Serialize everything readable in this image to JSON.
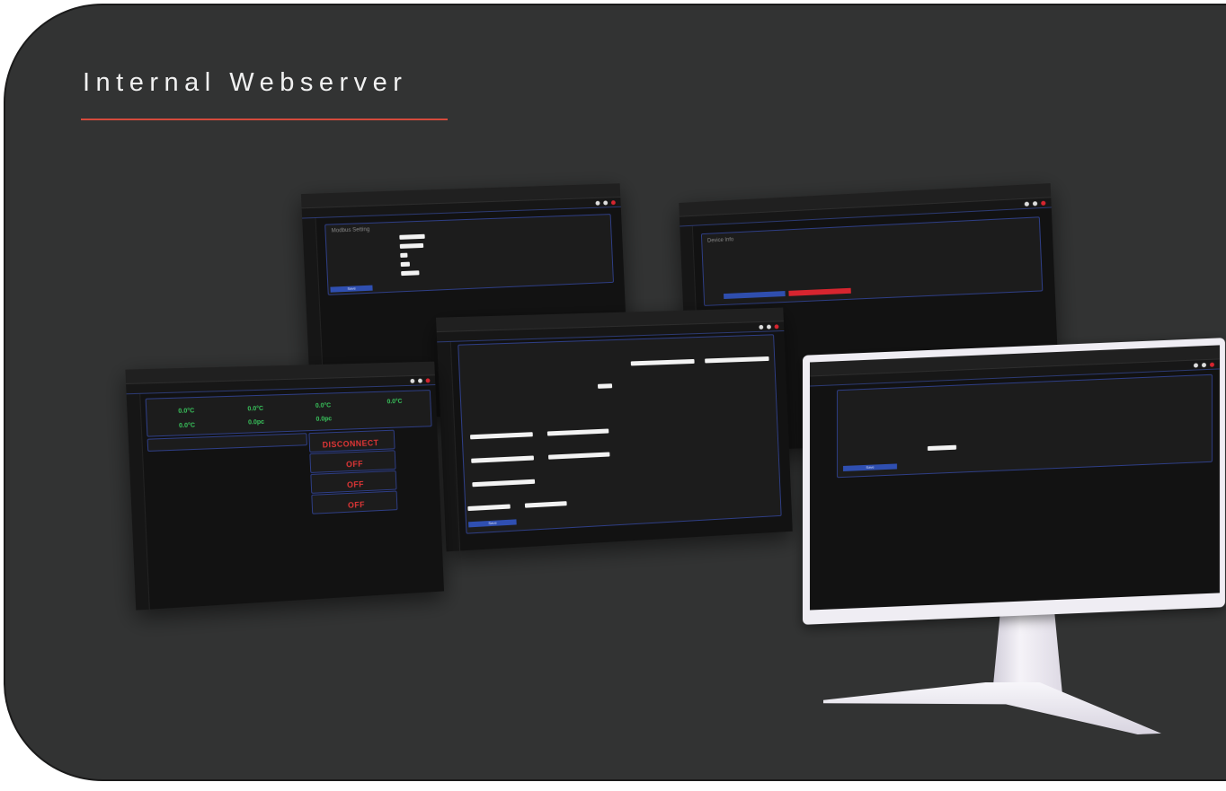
{
  "heading": {
    "title": "Internal Webserver"
  },
  "colors": {
    "background": "#323333",
    "accent_line": "#d54a3c",
    "screen_bg": "#121212",
    "card_border": "#2e3e86",
    "button_blue": "#2f4fb1",
    "button_red": "#d7252f",
    "value_green": "#39c45c",
    "status_red": "#e23636"
  },
  "screen_modbus": {
    "card_title": "Modbus Setting",
    "button": "Save"
  },
  "screen_device_info": {
    "card_title": "Device Info"
  },
  "screen_dashboard": {
    "temps": [
      "0.0°C",
      "0.0°C",
      "0.0°C",
      "0.0°C",
      "0.0°C"
    ],
    "flows": [
      "0.0pc",
      "0.0pc"
    ],
    "status": [
      "DISCONNECT",
      "OFF",
      "OFF",
      "OFF"
    ]
  },
  "screen_network": {
    "button": "Save"
  },
  "monitor": {
    "button": "Save"
  }
}
